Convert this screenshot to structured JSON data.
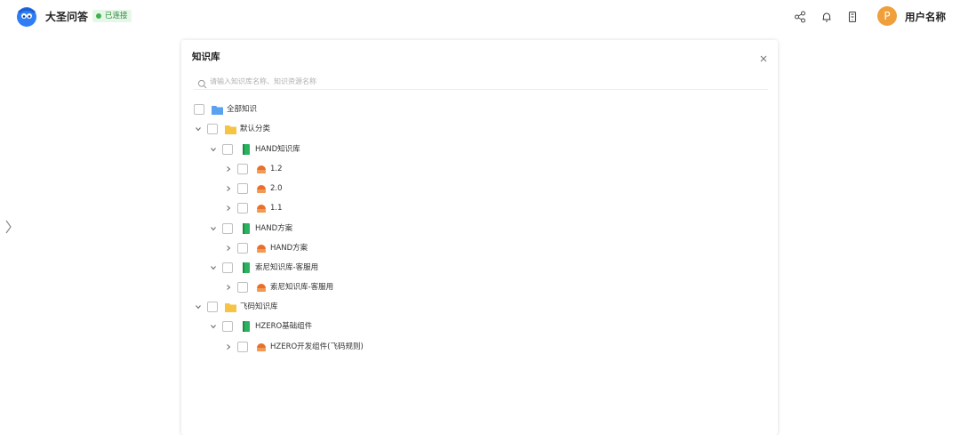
{
  "header": {
    "app_title": "大圣问答",
    "status": "已连接",
    "user_name": "用户名称",
    "avatar_letter": "P",
    "icons": [
      "share-icon",
      "bell-icon",
      "phone-icon"
    ]
  },
  "panel": {
    "title": "知识库",
    "close_label": "×",
    "search_placeholder": "请输入知识库名称、知识资源名称"
  },
  "tree": {
    "all": "全部知识",
    "default_category": "默认分类",
    "hand_kb": "HAND知识库",
    "v12": "1.2",
    "v20": "2.0",
    "v11": "1.1",
    "hand_plan": "HAND方案",
    "hand_plan_res": "HAND方案",
    "sony_kb": "索尼知识库-客服用",
    "sony_res": "索尼知识库-客服用",
    "feima_kb": "飞码知识库",
    "hzero_base": "HZERO基础组件",
    "hzero_dev": "HZERO开发组件(飞码规则)"
  },
  "colors": {
    "accent_blue": "#2f7ef5",
    "folder_blue": "#5aa2f0",
    "folder_yellow": "#f6c344",
    "book_green": "#29b35f",
    "resource_orange": "#e9702a",
    "avatar_orange": "#f0a03a",
    "status_green": "#3cb34a"
  }
}
